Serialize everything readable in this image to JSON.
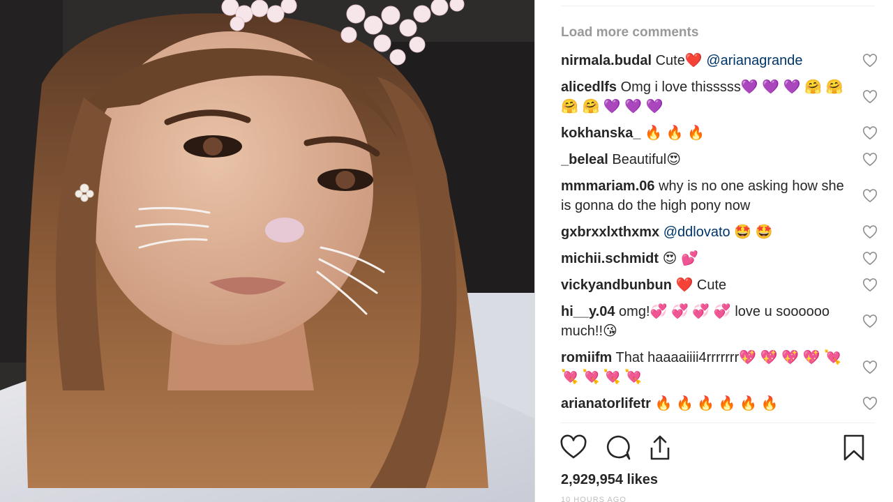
{
  "load_more_label": "Load more comments",
  "comments": [
    {
      "user": "nirmala.budal",
      "text": "Cute❤️",
      "mention": "@arianagrande"
    },
    {
      "user": "alicedlfs",
      "text": "Omg i love thisssss💜 💜 💜 🤗 🤗 🤗 🤗 💜 💜 💜",
      "mention": ""
    },
    {
      "user": "kokhanska_",
      "text": "🔥 🔥 🔥",
      "mention": ""
    },
    {
      "user": "_beleal",
      "text": "Beautiful😍",
      "mention": ""
    },
    {
      "user": "mmmariam.06",
      "text": "why is no one asking how she is gonna do the high pony now",
      "mention": ""
    },
    {
      "user": "gxbrxxlxthxmx",
      "text": "",
      "mention": "@ddlovato 🤩 🤩"
    },
    {
      "user": "michii.schmidt",
      "text": "😍 💕",
      "mention": ""
    },
    {
      "user": "vickyandbunbun",
      "text": "❤️ Cute",
      "mention": ""
    },
    {
      "user": "hi__y.04",
      "text": "omg!💞 💞 💞 💞 love u soooooo much!!😘",
      "mention": ""
    },
    {
      "user": "romiifm",
      "text": "That haaaaiiii4rrrrrrr💖 💖 💖 💖 💘 💘 💘 💘 💘",
      "mention": ""
    },
    {
      "user": "arianatorlifetr",
      "text": "🔥 🔥 🔥 🔥 🔥 🔥",
      "mention": ""
    }
  ],
  "likes_label": "2,929,954 likes",
  "timestamp": "10 HOURS AGO",
  "icons": {
    "like": "heart-outline-icon",
    "comment": "speech-bubble-icon",
    "share": "share-upload-icon",
    "save": "bookmark-icon",
    "comment_like": "small-heart-icon"
  },
  "colors": {
    "text": "#262626",
    "muted": "#999999",
    "mention": "#003569",
    "divider": "#efefef"
  }
}
